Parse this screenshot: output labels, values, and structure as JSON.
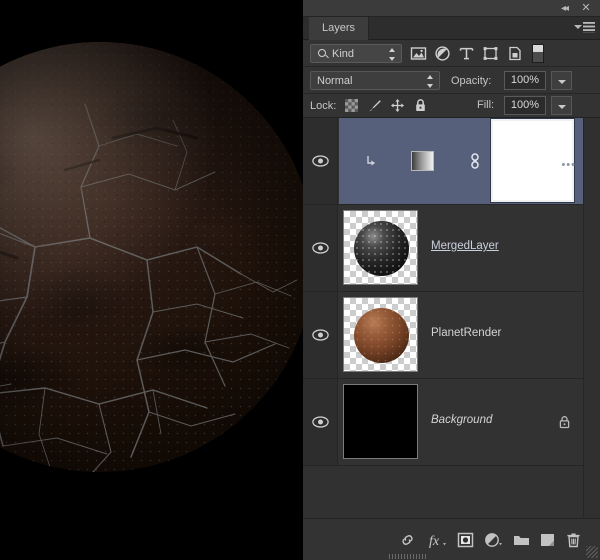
{
  "app": {
    "panel_title": "Layers"
  },
  "titlebar": {
    "collapse_icon": "double-left-chevron-icon",
    "collapse_glyph": "◂◂",
    "close_icon": "close-icon",
    "close_glyph": "✕"
  },
  "tabs": [
    {
      "label": "Layers",
      "active": true
    }
  ],
  "panel_menu": {
    "icon": "hamburger-menu-icon"
  },
  "filter_row": {
    "kind_label": "Kind",
    "search_icon": "magnifier-icon",
    "filter_icons": [
      {
        "name": "pixel-layers-filter-icon",
        "title": "Pixel layers"
      },
      {
        "name": "adjustment-layers-filter-icon",
        "title": "Adjustment layers"
      },
      {
        "name": "type-layers-filter-icon",
        "title": "Type layers"
      },
      {
        "name": "shape-layers-filter-icon",
        "title": "Shape layers"
      },
      {
        "name": "smart-object-filter-icon",
        "title": "Smart objects"
      }
    ],
    "toggle_name": "filter-enable-toggle"
  },
  "blend_row": {
    "blend_mode": "Normal",
    "opacity_label": "Opacity:",
    "opacity_value": "100%"
  },
  "lock_row": {
    "lock_label": "Lock:",
    "lock_icons": [
      {
        "name": "lock-transparency-icon"
      },
      {
        "name": "lock-image-pixels-icon"
      },
      {
        "name": "lock-position-icon"
      },
      {
        "name": "lock-all-icon"
      }
    ],
    "fill_label": "Fill:",
    "fill_value": "100%"
  },
  "layers": [
    {
      "name": "",
      "selected": true,
      "visible": true,
      "clipped": true,
      "linked": true,
      "has_mask": true,
      "thumb_type": "gradient",
      "ellipsis": "•••"
    },
    {
      "name": "MergedLayer ",
      "selected": false,
      "visible": true,
      "editing": true,
      "thumb_type": "dark-planet"
    },
    {
      "name": "PlanetRender",
      "selected": false,
      "visible": true,
      "thumb_type": "copper-planet"
    },
    {
      "name": "Background",
      "selected": false,
      "visible": true,
      "italic": true,
      "locked": true,
      "thumb_type": "black"
    }
  ],
  "bottom_toolbar": [
    {
      "name": "link-layers-button",
      "title": "Link layers"
    },
    {
      "name": "layer-style-fx-button",
      "title": "Add a layer style"
    },
    {
      "name": "add-layer-mask-button",
      "title": "Add layer mask"
    },
    {
      "name": "new-adjustment-layer-button",
      "title": "New fill or adjustment layer"
    },
    {
      "name": "new-group-button",
      "title": "Create a new group"
    },
    {
      "name": "new-layer-button",
      "title": "Create a new layer"
    },
    {
      "name": "delete-layer-button",
      "title": "Delete layer"
    }
  ],
  "canvas": {
    "title": "planet-render-canvas",
    "background_color": "#000000",
    "planet_color": "#6d4433"
  }
}
